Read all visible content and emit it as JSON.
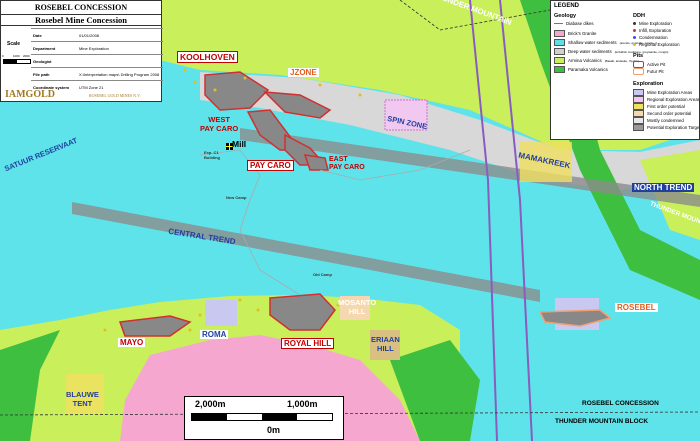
{
  "title_block": {
    "line1": "ROSEBEL CONCESSION",
    "line2": "Rosebel Mine Concession",
    "scale_label": "Scale",
    "scale_ticks": [
      "0",
      "1000",
      "2000"
    ],
    "company": "IAMGOLD",
    "subsidiary": "ROSEBEL GOLD MINES N.V.",
    "meta": [
      {
        "key": "Date",
        "value": "01/01/2008"
      },
      {
        "key": "Department",
        "value": "Mine Exploration"
      },
      {
        "key": "Geologist",
        "value": ""
      },
      {
        "key": "File path",
        "value": "X:\\Interpretation maps\\ Drilling Program 2008"
      },
      {
        "key": "Coordinate system",
        "value": "UTM Zone 21"
      }
    ]
  },
  "legend": {
    "title": "LEGEND",
    "geology_heading": "Geology",
    "geology_items": [
      {
        "label": "Diabase dikes",
        "color": "#8a5cc0",
        "kind": "line"
      },
      {
        "label": "Brick's Granite",
        "color": "#f5a7d0",
        "kind": "box"
      },
      {
        "label": "Shallow water sediments",
        "sub": "(arenite, quartzite, conglo...)",
        "color": "#5de0e8",
        "kind": "box"
      },
      {
        "label": "Deep water sediments",
        "sub": "(turbiditic mudstone, greywacke, conglo)",
        "color": "#d0d0d0",
        "kind": "box"
      },
      {
        "label": "Armina Volcanics",
        "sub": "(Basalt, andesite, rhyolite)",
        "color": "#c9ef5a",
        "kind": "box"
      },
      {
        "label": "Paramaka Volcanics",
        "color": "#3fbf3f",
        "kind": "box"
      }
    ],
    "ddh_heading": "DDH",
    "ddh_items": [
      {
        "label": "Mine Exploration",
        "color": "#333333"
      },
      {
        "label": "Infill, Exploration",
        "color": "#cc3333"
      },
      {
        "label": "Condemnation",
        "color": "#3355cc"
      },
      {
        "label": "Regional Exploration",
        "color": "#e0c020"
      }
    ],
    "pits_heading": "Pits",
    "pits_items": [
      {
        "label": "Active Pit",
        "color": "#d03030"
      },
      {
        "label": "Futur Pit",
        "color": "#f0a070"
      }
    ],
    "exploration_heading": "Exploration",
    "exploration_items": [
      {
        "label": "Mine Exploration Areas",
        "color": "#c8c8f0"
      },
      {
        "label": "Regional Exploration Areas",
        "color": "#f0c8f0"
      },
      {
        "label": "First order potential",
        "color": "#f0e060"
      },
      {
        "label": "Second order potential",
        "color": "#f5d8b0"
      },
      {
        "label": "Mostly condemned",
        "color": "#e8e8e8"
      },
      {
        "label": "Potential Exploration Targets",
        "color": "#999999"
      }
    ]
  },
  "map": {
    "labels": {
      "thunder_mountain_top": "THUNDER MOUNTAIN",
      "tatuur": "SATUUR RESERVAAT",
      "koolhoven": "KOOLHOVEN",
      "jzone": "JZONE",
      "west_pay_caro_1": "WEST",
      "west_pay_caro_2": "PAY CARO",
      "mill": "Mill",
      "pay_caro": "PAY CARO",
      "east_pay_caro_1": "EAST",
      "east_pay_caro_2": "PAY CARO",
      "spin_zone": "SPIN ZONE",
      "mamakreek": "MAMAKREEK",
      "north_trend": "NORTH TREND",
      "central_trend": "CENTRAL TREND",
      "thunder_mountain_right": "THUNDER MOUNTAIN",
      "new_camp": "New Camp",
      "old_camp": "Old Camp",
      "mosanto_1": "MOSANTO",
      "mosanto_2": "HILL",
      "royal_hill": "ROYAL HILL",
      "eriaan_1": "ERIAAN",
      "eriaan_2": "HILL",
      "roma": "ROMA",
      "mayo": "MAYO",
      "rosebel": "ROSEBEL",
      "blauwe_1": "BLAUWE",
      "blauwe_2": "TENT",
      "rosebel_concession": "ROSEBEL CONCESSION",
      "thunder_mountain_block": "THUNDER MOUNTAIN BLOCK",
      "exp_c1": "Exp. C1",
      "building": "Building"
    },
    "scalebar": {
      "left": "2,000m",
      "mid": "1,000m",
      "zero": "0m"
    }
  }
}
